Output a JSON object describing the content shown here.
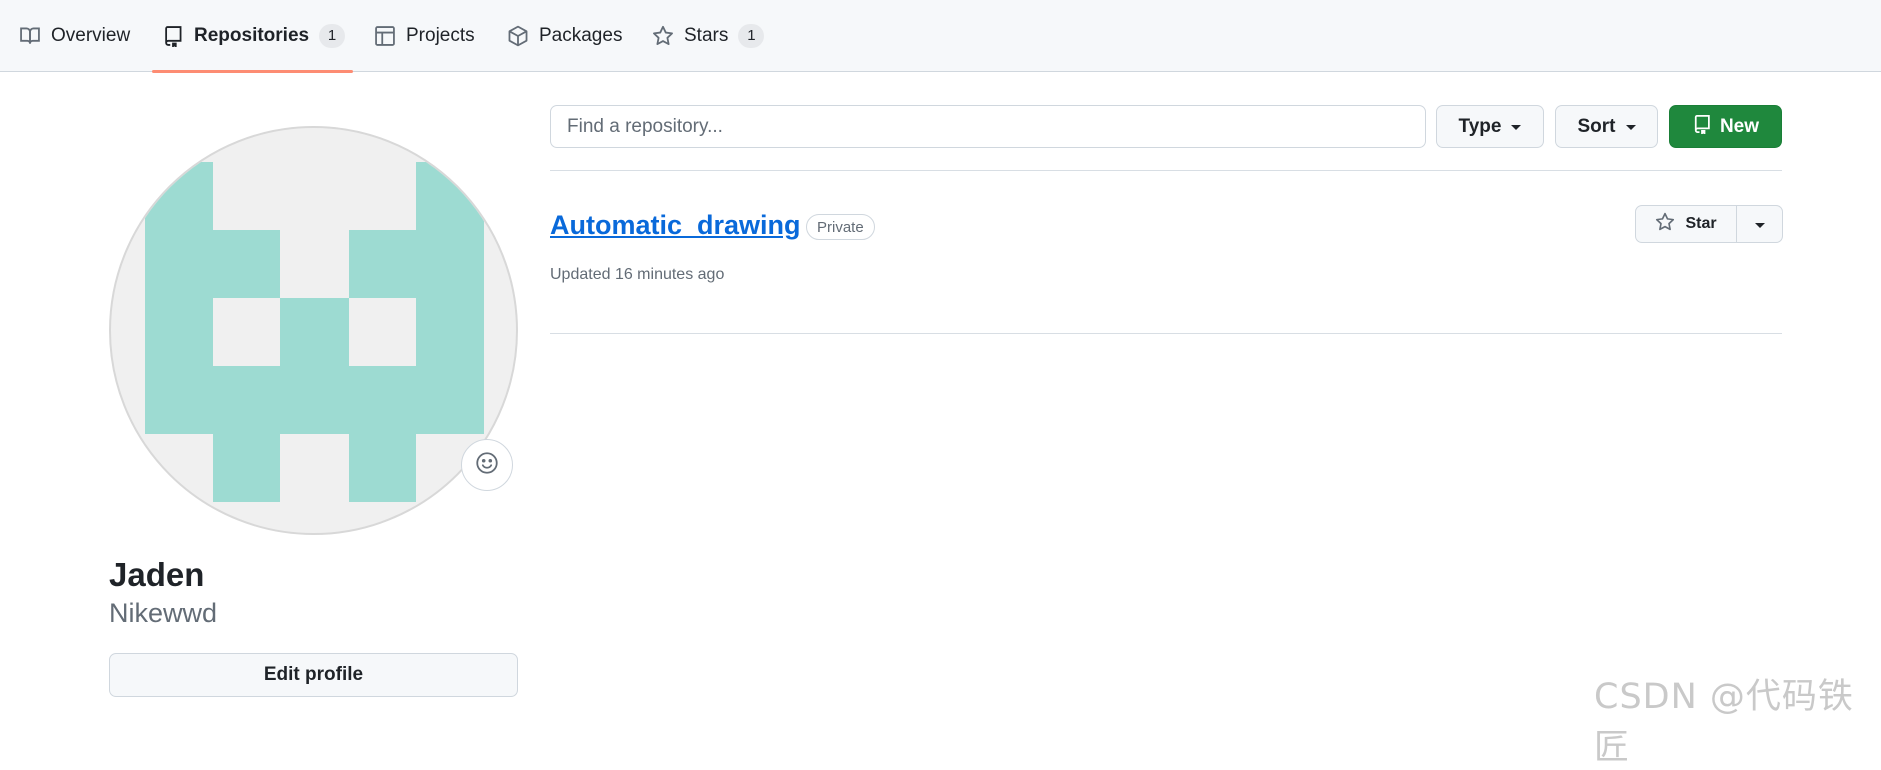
{
  "nav": {
    "tabs": [
      {
        "label": "Overview",
        "icon": "book-icon"
      },
      {
        "label": "Repositories",
        "icon": "repo-icon",
        "count": "1",
        "active": true
      },
      {
        "label": "Projects",
        "icon": "table-icon"
      },
      {
        "label": "Packages",
        "icon": "package-icon"
      },
      {
        "label": "Stars",
        "icon": "star-icon",
        "count": "1"
      }
    ]
  },
  "profile": {
    "name": "Jaden",
    "login": "Nikewwd",
    "edit_label": "Edit profile",
    "avatar_color": "#9ddbd2",
    "avatar_bg": "#f0f0f0"
  },
  "filters": {
    "search_placeholder": "Find a repository...",
    "type_label": "Type",
    "sort_label": "Sort",
    "new_label": "New"
  },
  "repos": [
    {
      "name": "Automatic_drawing",
      "visibility": "Private",
      "updated": "Updated 16 minutes ago",
      "star_label": "Star"
    }
  ],
  "colors": {
    "accent_underline": "#fd8c73",
    "link": "#0969da",
    "primary_green": "#1f883d"
  },
  "watermark": "CSDN @代码铁匠"
}
